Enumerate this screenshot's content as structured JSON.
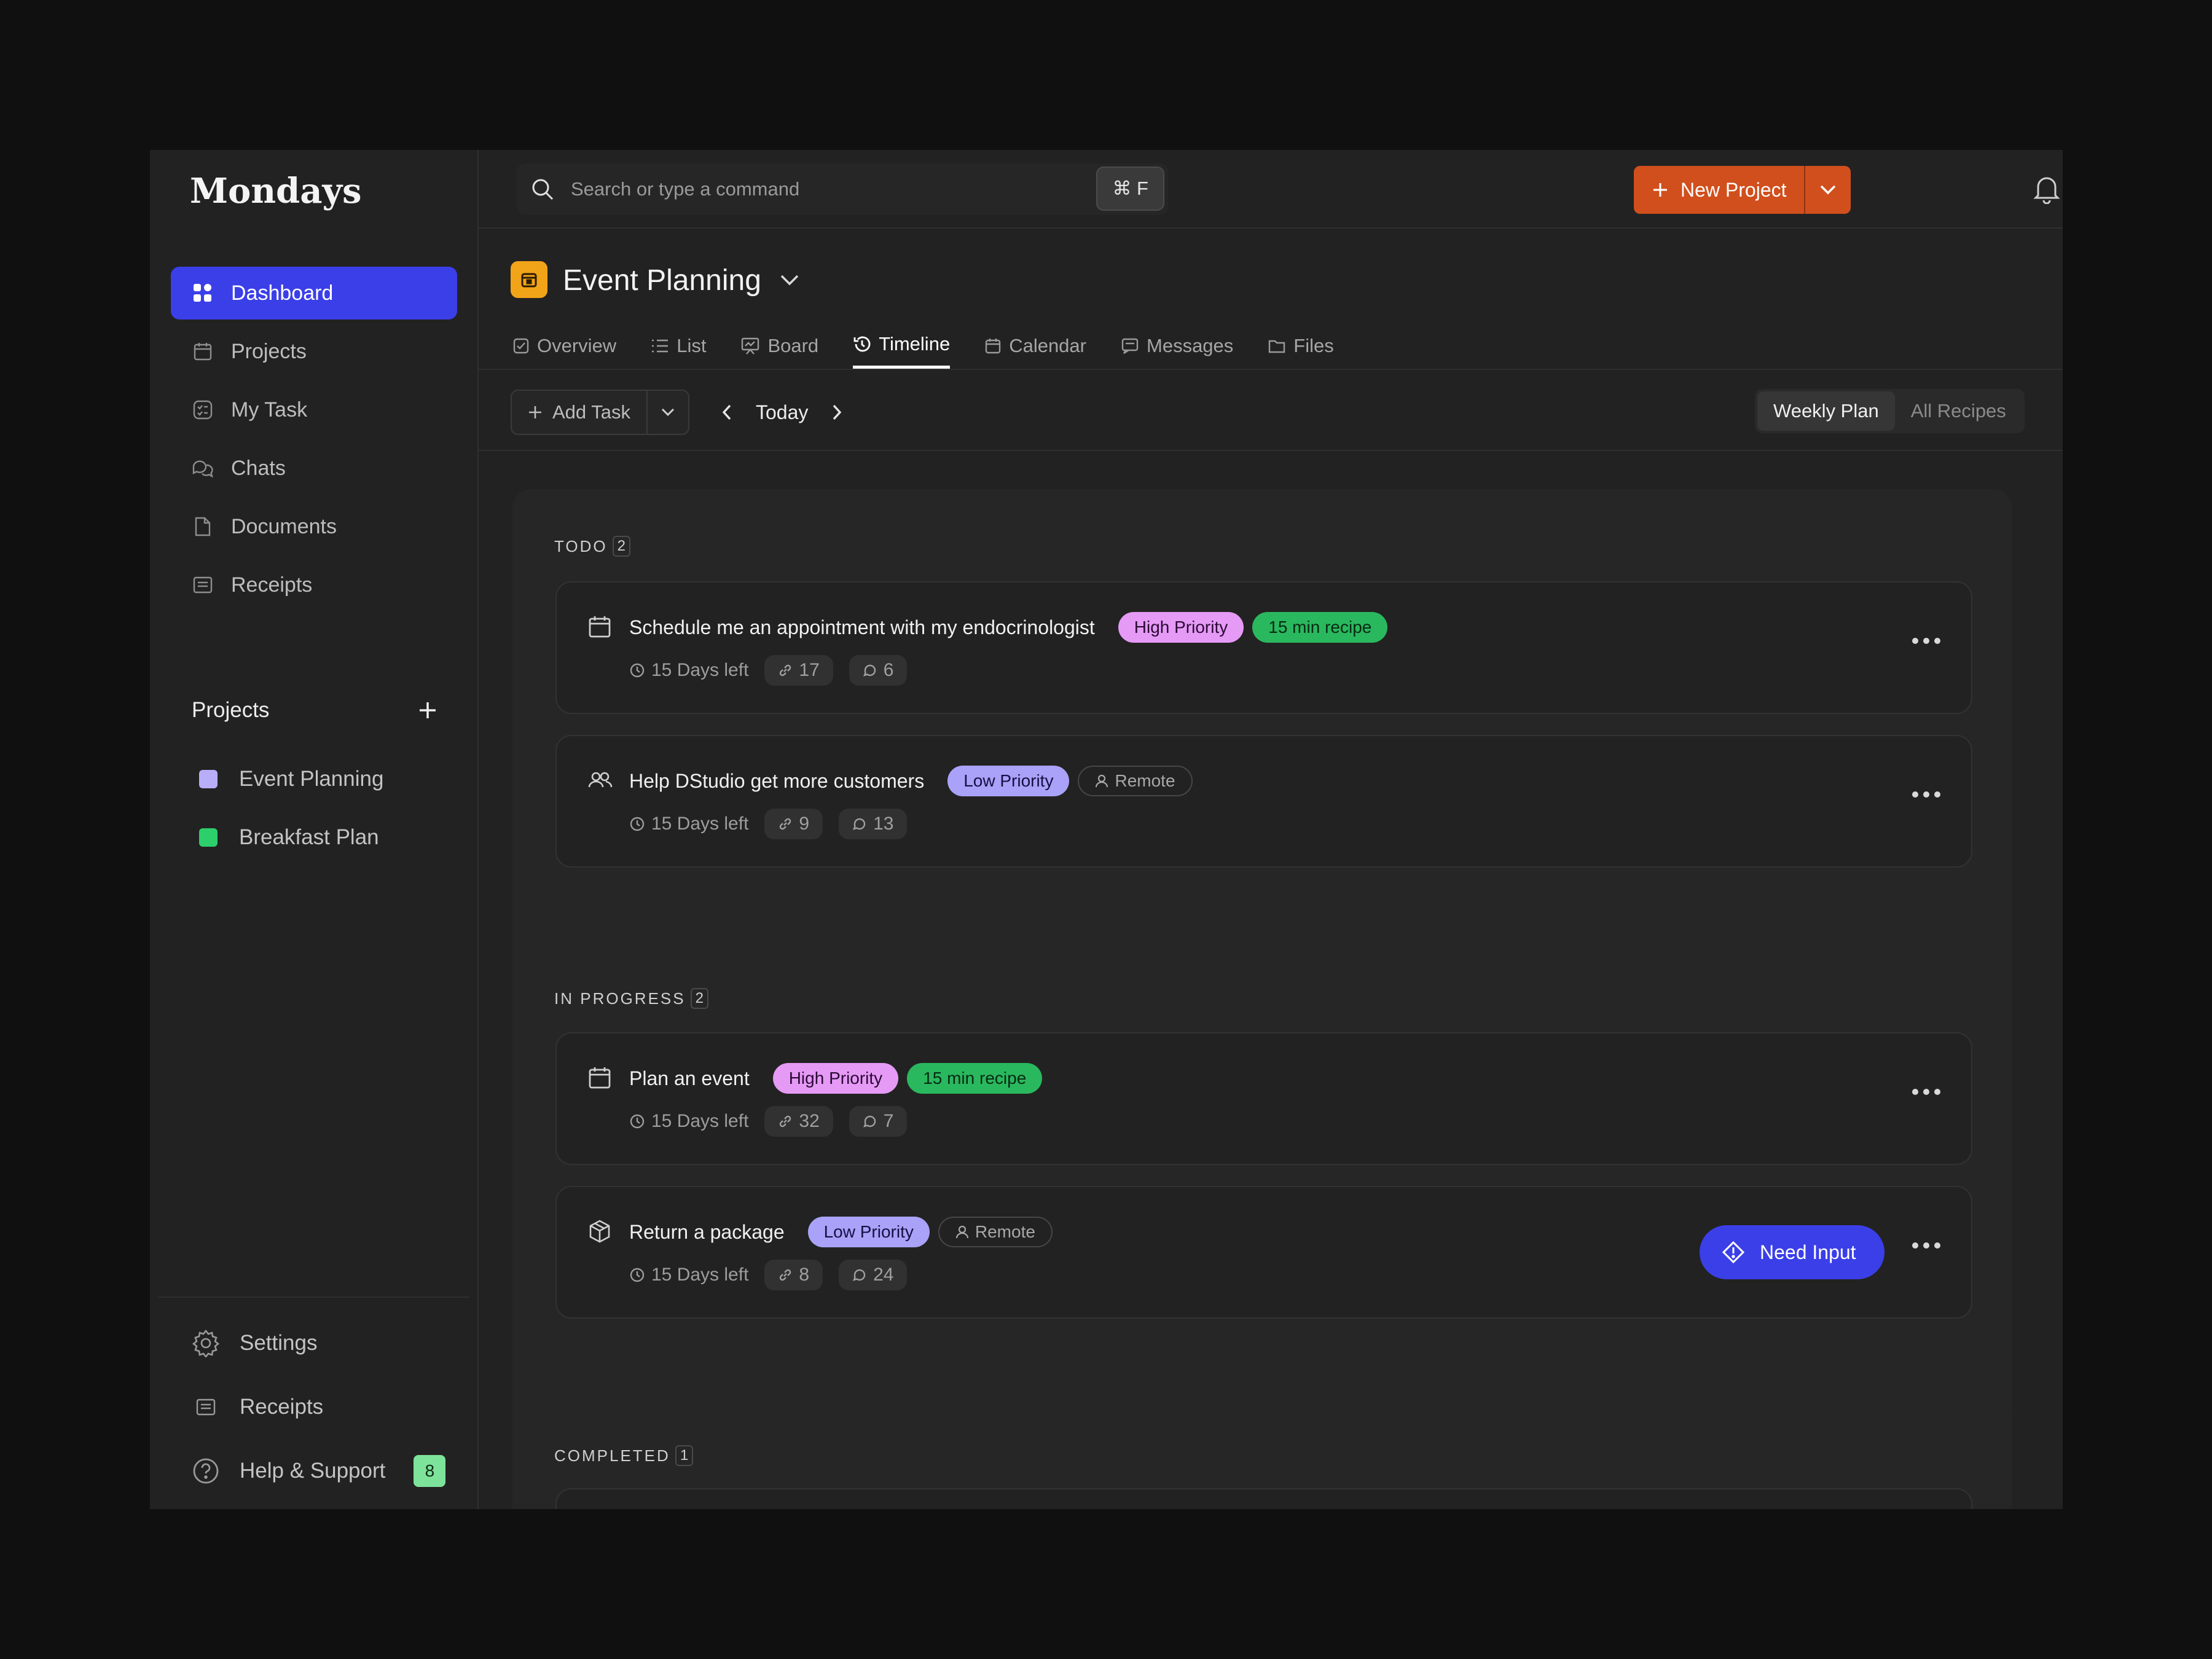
{
  "app": {
    "name": "Mondays"
  },
  "sidebar": {
    "items": [
      {
        "label": "Dashboard",
        "icon": "grid-icon",
        "active": true
      },
      {
        "label": "Projects",
        "icon": "calendar-icon"
      },
      {
        "label": "My Task",
        "icon": "checklist-icon"
      },
      {
        "label": "Chats",
        "icon": "chat-bubbles-icon"
      },
      {
        "label": "Documents",
        "icon": "document-icon"
      },
      {
        "label": "Receipts",
        "icon": "receipt-icon"
      }
    ],
    "projects_heading": "Projects",
    "projects": [
      {
        "label": "Event Planning",
        "color": "#b8aef8"
      },
      {
        "label": "Breakfast Plan",
        "color": "#2ccf6a"
      }
    ],
    "bottom": [
      {
        "label": "Settings",
        "icon": "gear-icon"
      },
      {
        "label": "Receipts",
        "icon": "receipt-icon"
      },
      {
        "label": "Help & Support",
        "icon": "help-icon",
        "badge": "8"
      }
    ]
  },
  "topbar": {
    "search_placeholder": "Search or type a command",
    "shortcut": "⌘ F",
    "new_project_label": "New Project",
    "accent": "#d14f1c",
    "notification_dot_color": "#e49ef5"
  },
  "project": {
    "title": "Event Planning",
    "icon_color": "#f2a418",
    "tabs": [
      {
        "label": "Overview",
        "icon": "checkbox-icon"
      },
      {
        "label": "List",
        "icon": "list-icon"
      },
      {
        "label": "Board",
        "icon": "board-icon"
      },
      {
        "label": "Timeline",
        "icon": "history-icon",
        "active": true
      },
      {
        "label": "Calendar",
        "icon": "calendar-icon"
      },
      {
        "label": "Messages",
        "icon": "message-icon"
      },
      {
        "label": "Files",
        "icon": "folder-icon"
      }
    ]
  },
  "toolbar": {
    "add_task_label": "Add Task",
    "date_label": "Today",
    "views": [
      {
        "label": "Weekly Plan",
        "active": true
      },
      {
        "label": "All Recipes"
      }
    ]
  },
  "sections": [
    {
      "title": "TODO",
      "count": "2",
      "tasks": [
        {
          "icon": "calendar-icon",
          "title": "Schedule me an appointment with my endocrinologist",
          "priority": "High Priority",
          "tag": "15 min recipe",
          "days": "15 Days left",
          "links": "17",
          "comments": "6"
        },
        {
          "icon": "users-icon",
          "title": "Help DStudio get more customers",
          "priority": "Low Priority",
          "tag": "Remote",
          "days": "15 Days left",
          "links": "9",
          "comments": "13"
        }
      ]
    },
    {
      "title": "IN PROGRESS",
      "count": "2",
      "tasks": [
        {
          "icon": "calendar-icon",
          "title": "Plan an event",
          "priority": "High Priority",
          "tag": "15 min recipe",
          "days": "15 Days left",
          "links": "32",
          "comments": "7"
        },
        {
          "icon": "package-icon",
          "title": "Return a package",
          "priority": "Low Priority",
          "tag": "Remote",
          "days": "15 Days left",
          "links": "8",
          "comments": "24",
          "action": "Need Input"
        }
      ]
    },
    {
      "title": "COMPLETED",
      "count": "1",
      "tasks": []
    }
  ]
}
